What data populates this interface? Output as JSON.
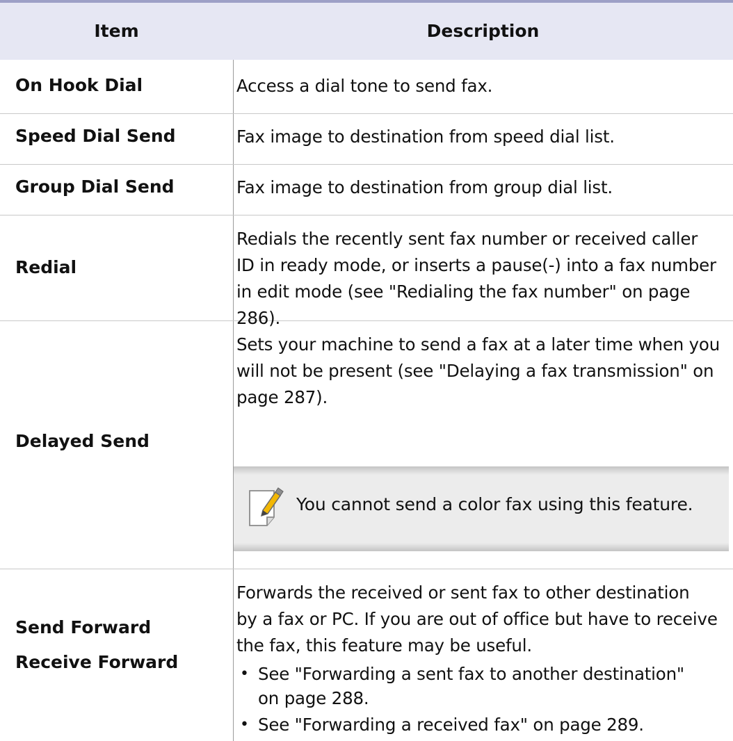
{
  "table": {
    "headers": {
      "item": "Item",
      "description": "Description"
    },
    "rows": [
      {
        "item": "On Hook Dial",
        "description": "Access a dial tone to send fax."
      },
      {
        "item": "Speed Dial Send",
        "description": "Fax image to destination from speed dial list."
      },
      {
        "item": "Group Dial Send",
        "description": "Fax image to destination from group dial list."
      },
      {
        "item": "Redial",
        "description_lines": [
          "Redials the recently sent fax number or received caller",
          "ID in ready mode, or inserts a pause(-) into a fax number",
          "in edit mode (see \"Redialing the fax number\" on page",
          "286)."
        ]
      },
      {
        "item": "Delayed Send",
        "description_lines": [
          "Sets your machine to send a fax at a later time when you",
          "will not be present (see \"Delaying a fax transmission\" on",
          "page 287)."
        ],
        "note": "You cannot send a color fax using this feature."
      },
      {
        "items": [
          "Send Forward",
          "Receive Forward"
        ],
        "description_lines": [
          "Forwards the received or sent fax to other destination",
          "by a fax or PC. If you are out of office but have to receive",
          "the fax, this feature may be useful."
        ],
        "bullets": [
          {
            "lines": [
              "See \"Forwarding a sent fax to another destination\"",
              "on page 288."
            ]
          },
          {
            "lines": [
              "See \"Forwarding a received fax\" on page 289."
            ]
          }
        ]
      }
    ]
  },
  "icons": {
    "note": "note-pencil-icon",
    "bullet": "•"
  },
  "colors": {
    "header_bg": "#e6e7f3",
    "top_rule": "#9da0c6",
    "note_bg": "#ececec",
    "pencil": "#f2b705"
  }
}
